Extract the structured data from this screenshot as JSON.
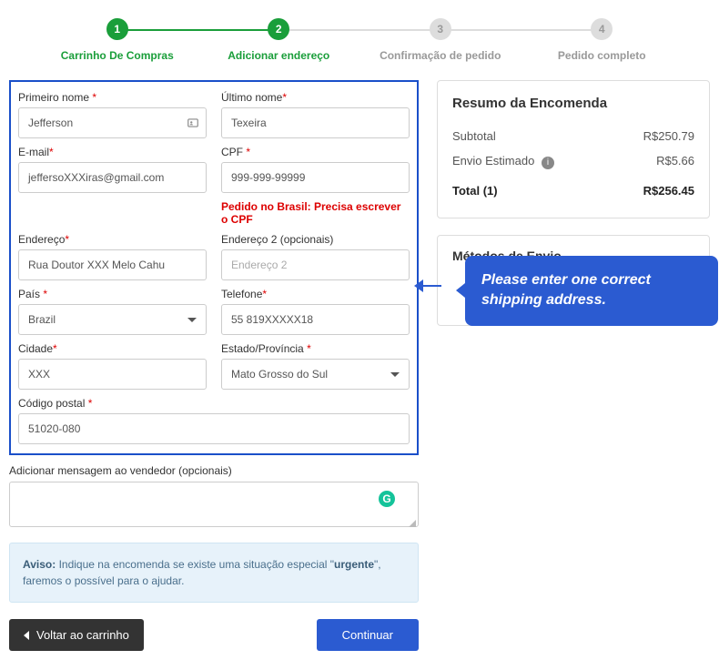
{
  "stepper": {
    "steps": [
      {
        "num": "1",
        "label": "Carrinho De Compras"
      },
      {
        "num": "2",
        "label": "Adicionar endereço"
      },
      {
        "num": "3",
        "label": "Confirmação de pedido"
      },
      {
        "num": "4",
        "label": "Pedido completo"
      }
    ]
  },
  "form": {
    "first_name_label": "Primeiro nome ",
    "first_name_value": "Jefferson",
    "last_name_label": "Último nome",
    "last_name_value": "Texeira",
    "email_label": "E-mail",
    "email_value": "jeffersoXXXiras@gmail.com",
    "cpf_label": "CPF ",
    "cpf_value": "999-999-99999",
    "cpf_error": "Pedido no Brasil: Precisa escrever o CPF",
    "addr1_label": "Endereço",
    "addr1_value": "Rua Doutor XXX Melo Cahu",
    "addr2_label": "Endereço 2 (opcionais)",
    "addr2_placeholder": "Endereço 2",
    "country_label": "País ",
    "country_value": "Brazil",
    "phone_label": "Telefone",
    "phone_value": "55 819XXXXX18",
    "city_label": "Cidade",
    "city_value": "XXX",
    "state_label": "Estado/Província ",
    "state_value": "Mato Grosso do Sul",
    "zip_label": "Código postal ",
    "zip_value": "51020-080"
  },
  "message": {
    "label": "Adicionar mensagem ao vendedor (opcionais)"
  },
  "notice": {
    "prefix": "Aviso: ",
    "text1": "Indique na encomenda se existe uma situação especial \"",
    "bold": "urgente",
    "text2": "\", faremos o possível para o ajudar."
  },
  "buttons": {
    "back": "Voltar ao carrinho",
    "continue": "Continuar"
  },
  "summary": {
    "title": "Resumo da Encomenda",
    "subtotal_label": "Subtotal",
    "subtotal_value": "R$250.79",
    "shipping_label": "Envio Estimado",
    "shipping_value": "R$5.66",
    "total_label": "Total (1)",
    "total_value": "R$256.45"
  },
  "shipping": {
    "title": "Métodos de Envio",
    "callout": "Please enter one correct shipping address."
  }
}
